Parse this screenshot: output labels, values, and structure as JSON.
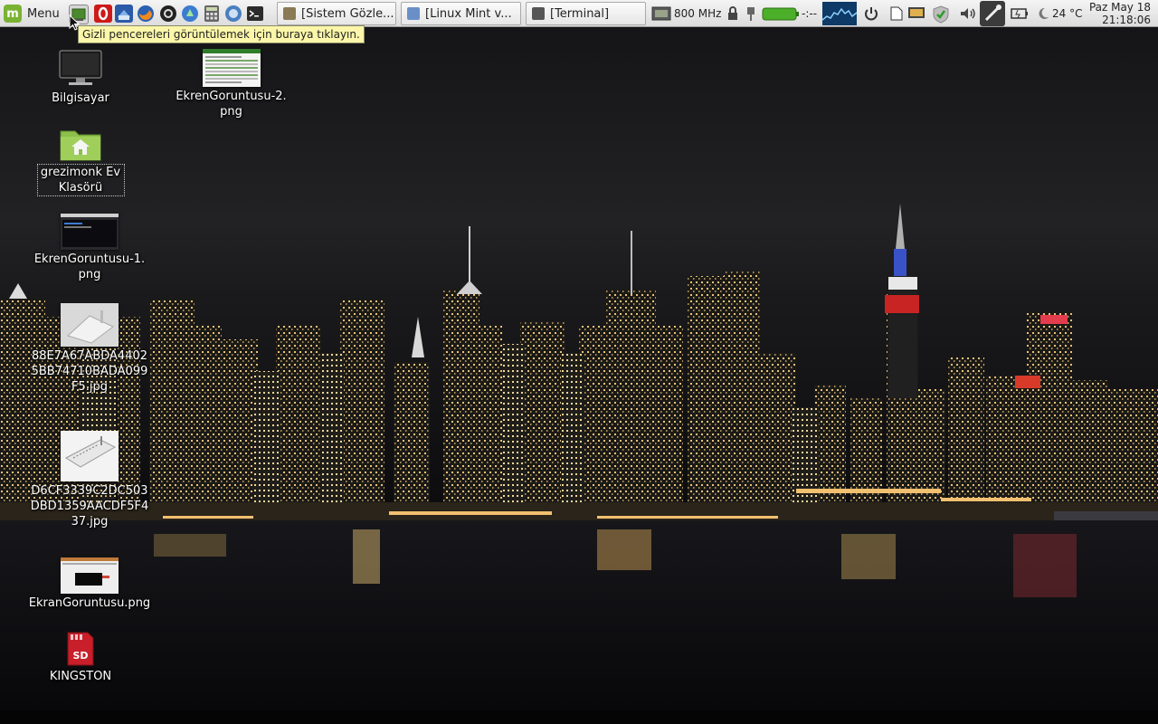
{
  "panel": {
    "menu_label": "Menu",
    "launchers": [
      "show-desktop-icon",
      "opera-icon",
      "thunderbird-icon",
      "firefox-icon",
      "software-manager-icon",
      "pidgin-icon",
      "calculator-icon",
      "system-monitor-icon",
      "terminal-icon"
    ],
    "windows": [
      {
        "label": "[Sistem Gözle...",
        "icon": "system-monitor-icon"
      },
      {
        "label": "[Linux Mint v...",
        "icon": "browser-icon"
      },
      {
        "label": "[Terminal]",
        "icon": "terminal-icon"
      }
    ],
    "tray": {
      "cpu_freq": "800 MHz",
      "battery_time": "-:--",
      "temperature": "24 °C"
    },
    "clock": {
      "date": "Paz May 18",
      "time": "21:18:06"
    }
  },
  "tooltip": {
    "text": "Gizli pencereleri görüntülemek için buraya tıklayın."
  },
  "desktop": {
    "icons": [
      {
        "label": "Bilgisayar",
        "type": "computer-icon"
      },
      {
        "label": "EkrenGoruntusu-2.png",
        "type": "image-thumbnail"
      },
      {
        "label": "grezimonk Ev Klasörü",
        "type": "home-folder-icon"
      },
      {
        "label": "EkrenGoruntusu-1.png",
        "type": "image-thumbnail"
      },
      {
        "label": "88E7A67ABDA44025BB74710BADA099F5.jpg",
        "type": "image-thumbnail"
      },
      {
        "label": "D6CF3339C2DC503DBD1359AACDF5F437.jpg",
        "type": "image-thumbnail"
      },
      {
        "label": "EkranGoruntusu.png",
        "type": "image-thumbnail"
      },
      {
        "label": "KINGSTON",
        "type": "sd-card-icon"
      }
    ]
  },
  "colors": {
    "panel_bg": "#e8e8e8",
    "tooltip_bg": "#fbf6a9",
    "mint_green": "#7ab233",
    "battery_green": "#4caf2a"
  }
}
